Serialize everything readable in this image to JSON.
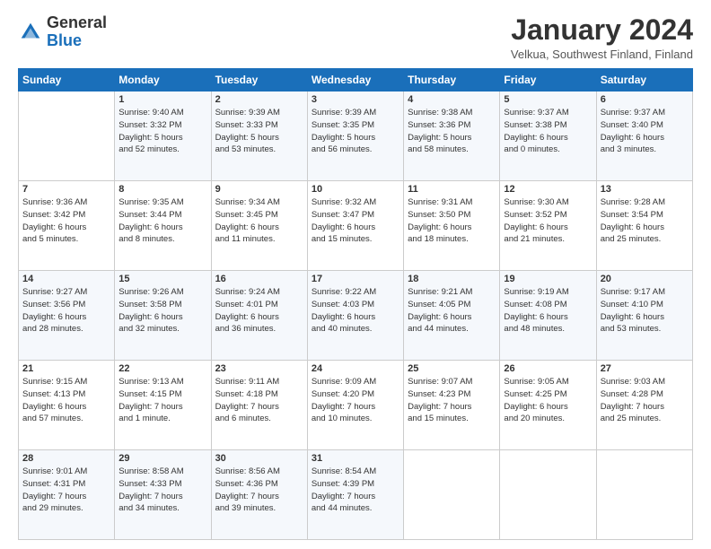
{
  "header": {
    "logo_general": "General",
    "logo_blue": "Blue",
    "month_title": "January 2024",
    "location": "Velkua, Southwest Finland, Finland"
  },
  "weekdays": [
    "Sunday",
    "Monday",
    "Tuesday",
    "Wednesday",
    "Thursday",
    "Friday",
    "Saturday"
  ],
  "weeks": [
    [
      {
        "day": "",
        "info": ""
      },
      {
        "day": "1",
        "info": "Sunrise: 9:40 AM\nSunset: 3:32 PM\nDaylight: 5 hours\nand 52 minutes."
      },
      {
        "day": "2",
        "info": "Sunrise: 9:39 AM\nSunset: 3:33 PM\nDaylight: 5 hours\nand 53 minutes."
      },
      {
        "day": "3",
        "info": "Sunrise: 9:39 AM\nSunset: 3:35 PM\nDaylight: 5 hours\nand 56 minutes."
      },
      {
        "day": "4",
        "info": "Sunrise: 9:38 AM\nSunset: 3:36 PM\nDaylight: 5 hours\nand 58 minutes."
      },
      {
        "day": "5",
        "info": "Sunrise: 9:37 AM\nSunset: 3:38 PM\nDaylight: 6 hours\nand 0 minutes."
      },
      {
        "day": "6",
        "info": "Sunrise: 9:37 AM\nSunset: 3:40 PM\nDaylight: 6 hours\nand 3 minutes."
      }
    ],
    [
      {
        "day": "7",
        "info": "Sunrise: 9:36 AM\nSunset: 3:42 PM\nDaylight: 6 hours\nand 5 minutes."
      },
      {
        "day": "8",
        "info": "Sunrise: 9:35 AM\nSunset: 3:44 PM\nDaylight: 6 hours\nand 8 minutes."
      },
      {
        "day": "9",
        "info": "Sunrise: 9:34 AM\nSunset: 3:45 PM\nDaylight: 6 hours\nand 11 minutes."
      },
      {
        "day": "10",
        "info": "Sunrise: 9:32 AM\nSunset: 3:47 PM\nDaylight: 6 hours\nand 15 minutes."
      },
      {
        "day": "11",
        "info": "Sunrise: 9:31 AM\nSunset: 3:50 PM\nDaylight: 6 hours\nand 18 minutes."
      },
      {
        "day": "12",
        "info": "Sunrise: 9:30 AM\nSunset: 3:52 PM\nDaylight: 6 hours\nand 21 minutes."
      },
      {
        "day": "13",
        "info": "Sunrise: 9:28 AM\nSunset: 3:54 PM\nDaylight: 6 hours\nand 25 minutes."
      }
    ],
    [
      {
        "day": "14",
        "info": "Sunrise: 9:27 AM\nSunset: 3:56 PM\nDaylight: 6 hours\nand 28 minutes."
      },
      {
        "day": "15",
        "info": "Sunrise: 9:26 AM\nSunset: 3:58 PM\nDaylight: 6 hours\nand 32 minutes."
      },
      {
        "day": "16",
        "info": "Sunrise: 9:24 AM\nSunset: 4:01 PM\nDaylight: 6 hours\nand 36 minutes."
      },
      {
        "day": "17",
        "info": "Sunrise: 9:22 AM\nSunset: 4:03 PM\nDaylight: 6 hours\nand 40 minutes."
      },
      {
        "day": "18",
        "info": "Sunrise: 9:21 AM\nSunset: 4:05 PM\nDaylight: 6 hours\nand 44 minutes."
      },
      {
        "day": "19",
        "info": "Sunrise: 9:19 AM\nSunset: 4:08 PM\nDaylight: 6 hours\nand 48 minutes."
      },
      {
        "day": "20",
        "info": "Sunrise: 9:17 AM\nSunset: 4:10 PM\nDaylight: 6 hours\nand 53 minutes."
      }
    ],
    [
      {
        "day": "21",
        "info": "Sunrise: 9:15 AM\nSunset: 4:13 PM\nDaylight: 6 hours\nand 57 minutes."
      },
      {
        "day": "22",
        "info": "Sunrise: 9:13 AM\nSunset: 4:15 PM\nDaylight: 7 hours\nand 1 minute."
      },
      {
        "day": "23",
        "info": "Sunrise: 9:11 AM\nSunset: 4:18 PM\nDaylight: 7 hours\nand 6 minutes."
      },
      {
        "day": "24",
        "info": "Sunrise: 9:09 AM\nSunset: 4:20 PM\nDaylight: 7 hours\nand 10 minutes."
      },
      {
        "day": "25",
        "info": "Sunrise: 9:07 AM\nSunset: 4:23 PM\nDaylight: 7 hours\nand 15 minutes."
      },
      {
        "day": "26",
        "info": "Sunrise: 9:05 AM\nSunset: 4:25 PM\nDaylight: 6 hours\nand 20 minutes."
      },
      {
        "day": "27",
        "info": "Sunrise: 9:03 AM\nSunset: 4:28 PM\nDaylight: 7 hours\nand 25 minutes."
      }
    ],
    [
      {
        "day": "28",
        "info": "Sunrise: 9:01 AM\nSunset: 4:31 PM\nDaylight: 7 hours\nand 29 minutes."
      },
      {
        "day": "29",
        "info": "Sunrise: 8:58 AM\nSunset: 4:33 PM\nDaylight: 7 hours\nand 34 minutes."
      },
      {
        "day": "30",
        "info": "Sunrise: 8:56 AM\nSunset: 4:36 PM\nDaylight: 7 hours\nand 39 minutes."
      },
      {
        "day": "31",
        "info": "Sunrise: 8:54 AM\nSunset: 4:39 PM\nDaylight: 7 hours\nand 44 minutes."
      },
      {
        "day": "",
        "info": ""
      },
      {
        "day": "",
        "info": ""
      },
      {
        "day": "",
        "info": ""
      }
    ]
  ]
}
